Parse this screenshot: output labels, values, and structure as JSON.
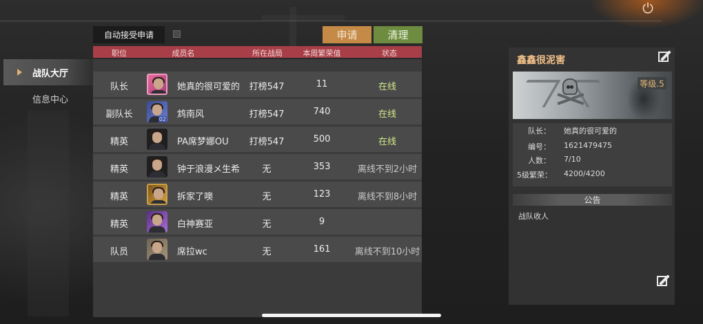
{
  "nav": {
    "items": [
      {
        "label": "战队大厅",
        "active": true
      },
      {
        "label": "信息中心",
        "active": false
      }
    ]
  },
  "toolbar": {
    "auto_accept_label": "自动接受申请",
    "auto_accept_checked": false,
    "apply_label": "申请",
    "clean_label": "清理"
  },
  "table": {
    "headers": [
      "职位",
      "成员名",
      "所在战局",
      "本周繁荣值",
      "状态"
    ],
    "rows": [
      {
        "role": "队长",
        "name": "她真的很可爱的",
        "match": "打榜547",
        "prosperity": "11",
        "status": "在线",
        "online": true,
        "avatar": "pink"
      },
      {
        "role": "副队长",
        "name": "鸩南风",
        "match": "打榜547",
        "prosperity": "740",
        "status": "在线",
        "online": true,
        "avatar": "blue",
        "avatar_badge": "02"
      },
      {
        "role": "精英",
        "name": "PA席梦娜OU",
        "match": "打榜547",
        "prosperity": "500",
        "status": "在线",
        "online": true,
        "avatar": "dark"
      },
      {
        "role": "精英",
        "name": "钟于浪漫メ生希",
        "match": "无",
        "prosperity": "353",
        "status": "离线不到2小时",
        "online": false,
        "avatar": "dark"
      },
      {
        "role": "精英",
        "name": "拆家了噢",
        "match": "无",
        "prosperity": "123",
        "status": "离线不到8小时",
        "online": false,
        "avatar": "gold"
      },
      {
        "role": "精英",
        "name": "白神赛亚",
        "match": "无",
        "prosperity": "9",
        "status": "",
        "online": false,
        "avatar": "purple"
      },
      {
        "role": "队员",
        "name": "席拉wc",
        "match": "无",
        "prosperity": "161",
        "status": "离线不到10小时",
        "online": false,
        "avatar": "grey"
      }
    ]
  },
  "team": {
    "name": "鑫鑫很泥害",
    "level": "等级.5",
    "info": [
      {
        "key": "队长：",
        "value": "她真的很可爱的"
      },
      {
        "key": "编号：",
        "value": "1621479475"
      },
      {
        "key": "人数：",
        "value": "7/10"
      },
      {
        "key": "5级繁荣：",
        "value": "4200/4200"
      }
    ],
    "notice_title": "公告",
    "notice_text": "战队收人"
  },
  "colors": {
    "online": "#cfe98a",
    "header_red": "#a83f48",
    "apply_orange": "#c58a46",
    "clean_green": "#6d8c3f",
    "team_name": "#f2c18a"
  },
  "icons": {
    "power": "power-icon",
    "edit": "edit-icon",
    "nav_arrow": "triangle-right-icon"
  }
}
